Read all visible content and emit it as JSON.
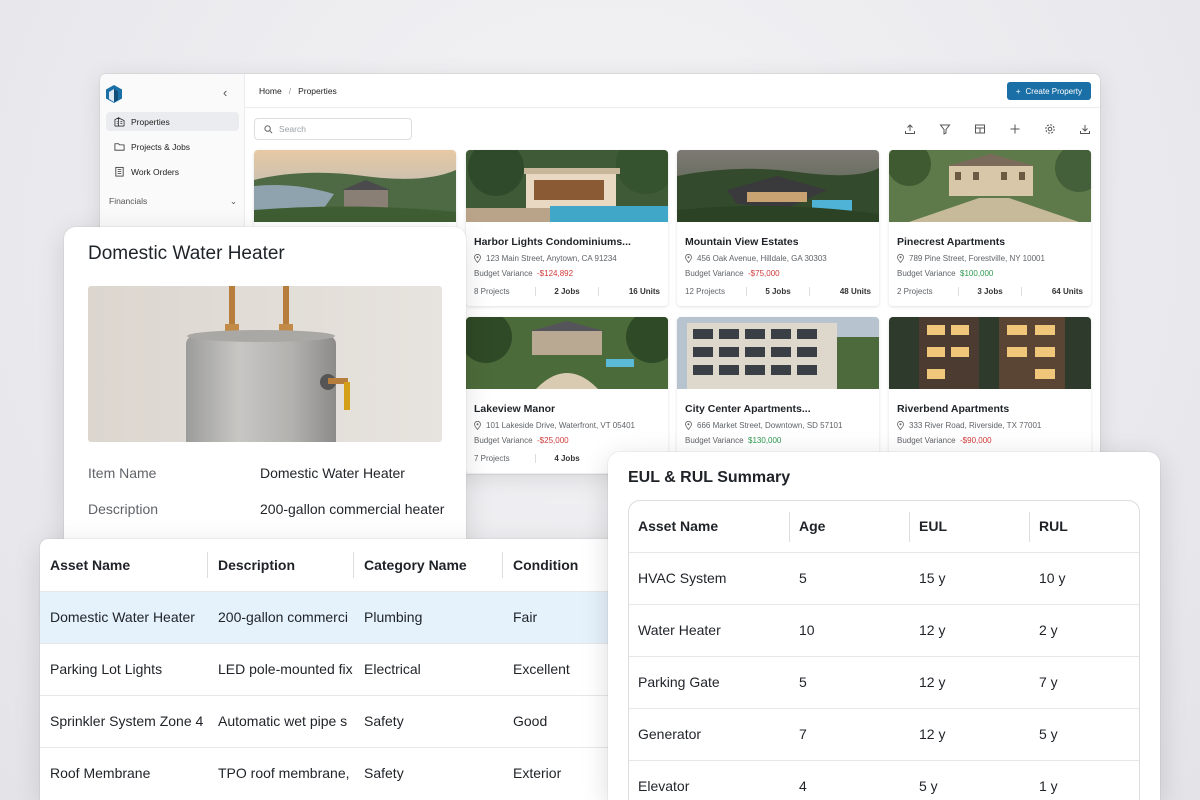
{
  "app": {
    "sidebar": {
      "items": [
        {
          "label": "Properties",
          "icon": "building-icon",
          "active": true
        },
        {
          "label": "Projects & Jobs",
          "icon": "folder-icon"
        },
        {
          "label": "Work Orders",
          "icon": "clipboard-icon"
        }
      ],
      "section": "Financials"
    },
    "breadcrumb": {
      "home": "Home",
      "current": "Properties"
    },
    "create_button": "Create Property",
    "search_placeholder": "Search",
    "toolbar_icons": [
      "upload-icon",
      "filter-icon",
      "columns-icon",
      "plus-icon",
      "settings-icon",
      "download-icon"
    ],
    "properties": [
      {
        "title": "Harbor Lights Condominiums...",
        "address": "123 Main Street, Anytown, CA 91234",
        "budget_label": "Budget Variance",
        "budget": "-$124,892",
        "status": "negative",
        "projects": "8 Projects",
        "jobs": "2 Jobs",
        "units": "16 Units"
      },
      {
        "title": "Mountain View Estates",
        "address": "456 Oak Avenue, Hilldale, GA 30303",
        "budget_label": "Budget Variance",
        "budget": "-$75,000",
        "status": "negative",
        "projects": "12 Projects",
        "jobs": "5 Jobs",
        "units": "48 Units"
      },
      {
        "title": "Pinecrest Apartments",
        "address": "789 Pine Street, Forestville, NY 10001",
        "budget_label": "Budget Variance",
        "budget": "$100,000",
        "status": "positive",
        "projects": "2 Projects",
        "jobs": "3 Jobs",
        "units": "64 Units"
      },
      {
        "title": "Lakeview Manor",
        "address": "101 Lakeside Drive, Waterfront, VT 05401",
        "budget_label": "Budget Variance",
        "budget": "-$25,000",
        "status": "negative",
        "projects": "7 Projects",
        "jobs": "4 Jobs",
        "units": ""
      },
      {
        "title": "City Center Apartments...",
        "address": "666 Market Street, Downtown, SD 57101",
        "budget_label": "Budget Variance",
        "budget": "$130,000",
        "status": "positive",
        "projects": "",
        "jobs": "",
        "units": ""
      },
      {
        "title": "Riverbend Apartments",
        "address": "333 River Road, Riverside, TX 77001",
        "budget_label": "Budget Variance",
        "budget": "-$90,000",
        "status": "negative",
        "projects": "",
        "jobs": "",
        "units": ""
      }
    ]
  },
  "asset_detail": {
    "title": "Domestic Water Heater",
    "fields": [
      {
        "label": "Item Name",
        "value": "Domestic Water Heater"
      },
      {
        "label": "Description",
        "value": "200-gallon commercial heater"
      }
    ]
  },
  "asset_table": {
    "headers": [
      "Asset Name",
      "Description",
      "Category Name",
      "Condition"
    ],
    "rows": [
      [
        "Domestic Water Heater",
        "200-gallon commerci",
        "Plumbing",
        "Fair"
      ],
      [
        "Parking Lot Lights",
        "LED pole-mounted fix",
        "Electrical",
        "Excellent"
      ],
      [
        "Sprinkler System Zone 4",
        "Automatic wet pipe s",
        "Safety",
        "Good"
      ],
      [
        "Roof Membrane",
        "TPO roof membrane,",
        "Safety",
        "Exterior"
      ]
    ]
  },
  "eul_summary": {
    "title": "EUL & RUL Summary",
    "headers": [
      "Asset Name",
      "Age",
      "EUL",
      "RUL"
    ],
    "rows": [
      [
        "HVAC System",
        "5",
        "15 y",
        "10 y"
      ],
      [
        "Water Heater",
        "10",
        "12 y",
        "2 y"
      ],
      [
        "Parking Gate",
        "5",
        "12 y",
        "7 y"
      ],
      [
        "Generator",
        "7",
        "12 y",
        "5 y"
      ],
      [
        "Elevator",
        "4",
        "5 y",
        "1 y"
      ]
    ]
  },
  "colors": {
    "accent": "#1a6fa6",
    "negative": "#d23a3a",
    "positive": "#2e9a4e",
    "selected_row": "#e5f1fb"
  }
}
